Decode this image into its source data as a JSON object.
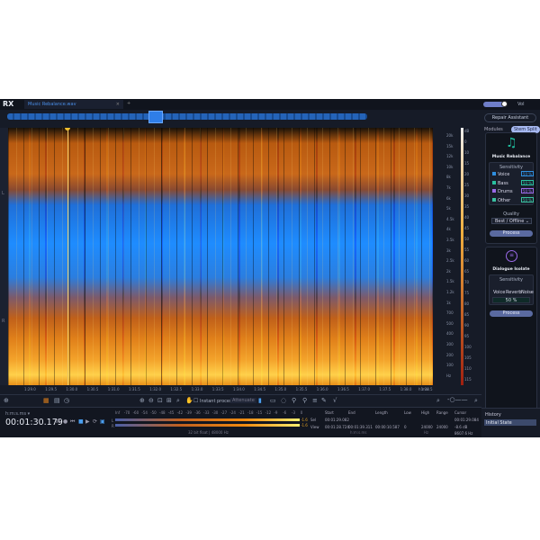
{
  "app": {
    "logo": "RX",
    "tab_title": "Music Rebalance.wav",
    "tab_close": "×",
    "new_tab": "+",
    "vol_label": "Vol"
  },
  "right": {
    "repair_assistant": "Repair Assistant",
    "modules": "Modules",
    "stem_split": "Stem Split",
    "music_rebalance": {
      "title": "Music Rebalance",
      "sensitivity": "Sensitivity",
      "rows": [
        {
          "label": "Voice",
          "value": "50 %",
          "color": "#2f8fe0"
        },
        {
          "label": "Bass",
          "value": "50 %",
          "color": "#2ac0a0"
        },
        {
          "label": "Drums",
          "value": "50 %",
          "color": "#9a6ae8"
        },
        {
          "label": "Other",
          "value": "50 %",
          "color": "#3ac0a0"
        }
      ],
      "quality_label": "Quality",
      "quality_value": "Best / Offline",
      "process": "Process"
    },
    "dialogue_isolate": {
      "title": "Dialogue Isolate",
      "sensitivity": "Sensitivity",
      "options": [
        "Voice",
        "Reverb",
        "Noise"
      ],
      "value": "50 %",
      "process": "Process"
    }
  },
  "history": {
    "title": "History",
    "items": [
      "Initial State"
    ]
  },
  "time_axis": [
    "1:29.0",
    "1:29.5",
    "1:30.0",
    "1:30.5",
    "1:31.0",
    "1:31.5",
    "1:32.0",
    "1:32.5",
    "1:33.0",
    "1:33.5",
    "1:34.0",
    "1:34.5",
    "1:35.0",
    "1:35.5",
    "1:36.0",
    "1:36.5",
    "1:37.0",
    "1:37.5",
    "1:38.0",
    "1:38.5"
  ],
  "time_unit": "h:m:s",
  "freq_axis": [
    "20k",
    "15k",
    "12k",
    "10k",
    "8k",
    "7k",
    "6k",
    "5k",
    "4.5k",
    "4k",
    "3.5k",
    "3k",
    "2.5k",
    "2k",
    "1.5k",
    "1.2k",
    "1k",
    "700",
    "500",
    "400",
    "300",
    "200",
    "100",
    "Hz"
  ],
  "db_axis": [
    "dB",
    "0",
    "10",
    "15",
    "20",
    "25",
    "30",
    "35",
    "40",
    "45",
    "50",
    "55",
    "60",
    "65",
    "70",
    "75",
    "80",
    "85",
    "90",
    "95",
    "100",
    "105",
    "110",
    "115"
  ],
  "toolbar": {
    "instant_process": "Instant process",
    "attenuate": "Attenuate"
  },
  "transport": {
    "format": "h:m:s.ms ▾",
    "timecode": "00:01:30.179"
  },
  "meter": {
    "scale": [
      "Inf",
      "-70",
      "-60",
      "-54",
      "-50",
      "-48",
      "-45",
      "-42",
      "-39",
      "-36",
      "-33",
      "-30",
      "-27",
      "-24",
      "-21",
      "-18",
      "-15",
      "-12",
      "-9",
      "-6",
      "-3",
      "0"
    ],
    "peak_l": "-1.6",
    "peak_r": "-1.6",
    "footer": "32 bit float | 48000 Hz",
    "channels": [
      "L",
      "R"
    ]
  },
  "selection": {
    "headers": [
      "Start",
      "End",
      "Length",
      "Low",
      "High",
      "Range",
      "Cursor"
    ],
    "sel_label": "Sel",
    "view_label": "View",
    "sel_start": "00:01:29.082",
    "view_start": "00:01:28.724",
    "view_end": "00:01:39.311",
    "view_length": "00:00:10.587",
    "low": "0",
    "high": "24000",
    "range": "24000",
    "unit_time": "h:m:s.ms",
    "unit_freq": "Hz",
    "cursor_time": "00:01:29.084",
    "cursor_db": "-8.6 dB",
    "cursor_freq": "8607.6 Hz"
  }
}
